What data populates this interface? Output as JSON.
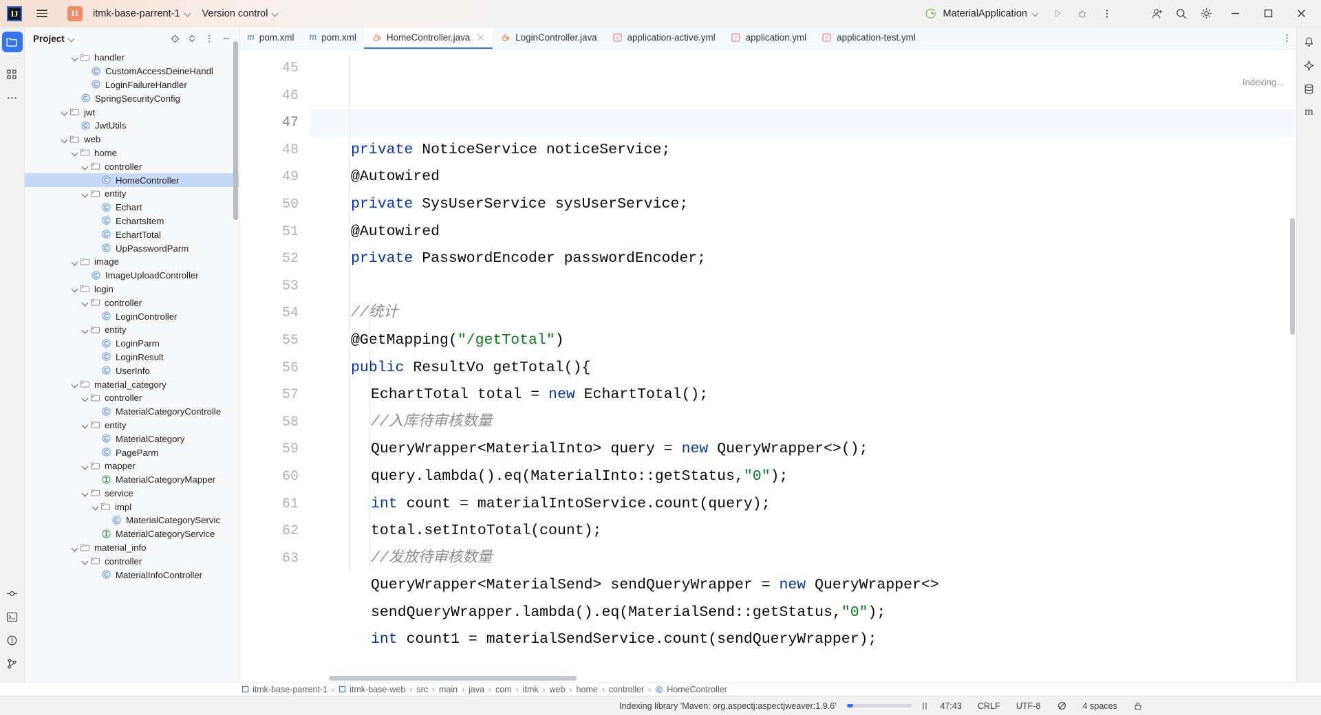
{
  "titlebar": {
    "logo_text": "IJ",
    "project_badge": "I1",
    "project_name": "itmk-base-parrent-1",
    "version_control": "Version control",
    "run_config": "MaterialApplication"
  },
  "project_panel": {
    "title": "Project",
    "tree": [
      {
        "depth": 4,
        "type": "folder",
        "label": "handler",
        "expanded": true
      },
      {
        "depth": 6,
        "type": "class",
        "label": "CustomAccessDeineHandl"
      },
      {
        "depth": 6,
        "type": "class",
        "label": "LoginFailureHandler"
      },
      {
        "depth": 5,
        "type": "class",
        "label": "SpringSecurityConfig"
      },
      {
        "depth": 3,
        "type": "folder",
        "label": "jwt",
        "expanded": true
      },
      {
        "depth": 5,
        "type": "class",
        "label": "JwtUtils"
      },
      {
        "depth": 3,
        "type": "folder",
        "label": "web",
        "expanded": true
      },
      {
        "depth": 4,
        "type": "folder",
        "label": "home",
        "expanded": true
      },
      {
        "depth": 5,
        "type": "folder",
        "label": "controller",
        "expanded": true
      },
      {
        "depth": 7,
        "type": "class",
        "label": "HomeController",
        "selected": true
      },
      {
        "depth": 5,
        "type": "folder",
        "label": "entity",
        "expanded": true
      },
      {
        "depth": 7,
        "type": "class",
        "label": "Echart"
      },
      {
        "depth": 7,
        "type": "class",
        "label": "EchartsItem"
      },
      {
        "depth": 7,
        "type": "class",
        "label": "EchartTotal"
      },
      {
        "depth": 7,
        "type": "class",
        "label": "UpPasswordParm"
      },
      {
        "depth": 4,
        "type": "folder",
        "label": "image",
        "expanded": true
      },
      {
        "depth": 6,
        "type": "class",
        "label": "ImageUploadController"
      },
      {
        "depth": 4,
        "type": "folder",
        "label": "login",
        "expanded": true
      },
      {
        "depth": 5,
        "type": "folder",
        "label": "controller",
        "expanded": true
      },
      {
        "depth": 7,
        "type": "class",
        "label": "LoginController"
      },
      {
        "depth": 5,
        "type": "folder",
        "label": "entity",
        "expanded": true
      },
      {
        "depth": 7,
        "type": "class",
        "label": "LoginParm"
      },
      {
        "depth": 7,
        "type": "class",
        "label": "LoginResult"
      },
      {
        "depth": 7,
        "type": "class",
        "label": "UserInfo"
      },
      {
        "depth": 4,
        "type": "folder",
        "label": "material_category",
        "expanded": true
      },
      {
        "depth": 5,
        "type": "folder",
        "label": "controller",
        "expanded": true
      },
      {
        "depth": 7,
        "type": "class",
        "label": "MaterialCategoryControlle"
      },
      {
        "depth": 5,
        "type": "folder",
        "label": "entity",
        "expanded": true
      },
      {
        "depth": 7,
        "type": "class",
        "label": "MaterialCategory"
      },
      {
        "depth": 7,
        "type": "class",
        "label": "PageParm"
      },
      {
        "depth": 5,
        "type": "folder",
        "label": "mapper",
        "expanded": true
      },
      {
        "depth": 7,
        "type": "interface",
        "label": "MaterialCategoryMapper"
      },
      {
        "depth": 5,
        "type": "folder",
        "label": "service",
        "expanded": true
      },
      {
        "depth": 6,
        "type": "folder",
        "label": "impl",
        "expanded": true
      },
      {
        "depth": 8,
        "type": "class",
        "label": "MaterialCategoryServic"
      },
      {
        "depth": 7,
        "type": "interface",
        "label": "MaterialCategoryService"
      },
      {
        "depth": 4,
        "type": "folder",
        "label": "material_info",
        "expanded": true
      },
      {
        "depth": 5,
        "type": "folder",
        "label": "controller",
        "expanded": true
      },
      {
        "depth": 7,
        "type": "class",
        "label": "MaterialInfoController"
      }
    ]
  },
  "editor": {
    "tabs": [
      {
        "label": "pom.xml",
        "icon": "maven-icon",
        "active": false,
        "closable": false
      },
      {
        "label": "pom.xml",
        "icon": "maven-icon",
        "active": false,
        "closable": false
      },
      {
        "label": "HomeController.java",
        "icon": "java-class-icon",
        "active": true,
        "closable": true
      },
      {
        "label": "LoginController.java",
        "icon": "java-class-icon",
        "active": false,
        "closable": false
      },
      {
        "label": "application-active.yml",
        "icon": "yaml-icon",
        "active": false,
        "closable": false
      },
      {
        "label": "application.yml",
        "icon": "yaml-icon",
        "active": false,
        "closable": false
      },
      {
        "label": "application-test.yml",
        "icon": "yaml-icon",
        "active": false,
        "closable": false
      }
    ],
    "indexing_badge": "Indexing...",
    "first_line_number": 45,
    "current_line": 47,
    "lines": [
      {
        "n": 45,
        "indent": 1,
        "tokens": [
          {
            "t": "private ",
            "c": "kw"
          },
          {
            "t": "NoticeService noticeService;",
            "c": ""
          }
        ]
      },
      {
        "n": 46,
        "indent": 1,
        "tokens": [
          {
            "t": "@Autowired",
            "c": ""
          }
        ]
      },
      {
        "n": 47,
        "indent": 1,
        "tokens": [
          {
            "t": "private ",
            "c": "kw"
          },
          {
            "t": "SysUserService sysUserService;",
            "c": ""
          }
        ]
      },
      {
        "n": 48,
        "indent": 1,
        "tokens": [
          {
            "t": "@Autowired",
            "c": ""
          }
        ]
      },
      {
        "n": 49,
        "indent": 1,
        "tokens": [
          {
            "t": "private ",
            "c": "kw"
          },
          {
            "t": "PasswordEncoder passwordEncoder;",
            "c": ""
          }
        ]
      },
      {
        "n": 50,
        "indent": 1,
        "tokens": []
      },
      {
        "n": 51,
        "indent": 1,
        "tokens": [
          {
            "t": "//统计",
            "c": "cmt"
          }
        ]
      },
      {
        "n": 52,
        "indent": 1,
        "tokens": [
          {
            "t": "@GetMapping(",
            "c": ""
          },
          {
            "t": "\"/getTotal\"",
            "c": "str"
          },
          {
            "t": ")",
            "c": ""
          }
        ]
      },
      {
        "n": 53,
        "indent": 1,
        "tokens": [
          {
            "t": "public ",
            "c": "kw"
          },
          {
            "t": "ResultVo getTotal(){",
            "c": ""
          }
        ]
      },
      {
        "n": 54,
        "indent": 2,
        "tokens": [
          {
            "t": "EchartTotal total = ",
            "c": ""
          },
          {
            "t": "new ",
            "c": "kw"
          },
          {
            "t": "EchartTotal();",
            "c": ""
          }
        ]
      },
      {
        "n": 55,
        "indent": 2,
        "tokens": [
          {
            "t": "//入库待审核数量",
            "c": "cmt"
          }
        ]
      },
      {
        "n": 56,
        "indent": 2,
        "tokens": [
          {
            "t": "QueryWrapper<MaterialInto> query = ",
            "c": ""
          },
          {
            "t": "new ",
            "c": "kw"
          },
          {
            "t": "QueryWrapper<>();",
            "c": ""
          }
        ]
      },
      {
        "n": 57,
        "indent": 2,
        "tokens": [
          {
            "t": "query.lambda().eq(MaterialInto::getStatus,",
            "c": ""
          },
          {
            "t": "\"0\"",
            "c": "str"
          },
          {
            "t": ");",
            "c": ""
          }
        ]
      },
      {
        "n": 58,
        "indent": 2,
        "tokens": [
          {
            "t": "int ",
            "c": "kw"
          },
          {
            "t": "count = materialIntoService.count(query);",
            "c": ""
          }
        ]
      },
      {
        "n": 59,
        "indent": 2,
        "tokens": [
          {
            "t": "total.setIntoTotal(count);",
            "c": ""
          }
        ]
      },
      {
        "n": 60,
        "indent": 2,
        "tokens": [
          {
            "t": "//发放待审核数量",
            "c": "cmt"
          }
        ]
      },
      {
        "n": 61,
        "indent": 2,
        "tokens": [
          {
            "t": "QueryWrapper<MaterialSend> sendQueryWrapper = ",
            "c": ""
          },
          {
            "t": "new ",
            "c": "kw"
          },
          {
            "t": "QueryWrapper<>",
            "c": ""
          }
        ]
      },
      {
        "n": 62,
        "indent": 2,
        "tokens": [
          {
            "t": "sendQueryWrapper.lambda().eq(MaterialSend::getStatus,",
            "c": ""
          },
          {
            "t": "\"0\"",
            "c": "str"
          },
          {
            "t": ");",
            "c": ""
          }
        ]
      },
      {
        "n": 63,
        "indent": 2,
        "tokens": [
          {
            "t": "int ",
            "c": "kw"
          },
          {
            "t": "count1 = materialSendService.count(sendQueryWrapper);",
            "c": ""
          }
        ]
      }
    ]
  },
  "breadcrumb": [
    {
      "label": "itmk-base-parrent-1",
      "icon": "module-icon"
    },
    {
      "label": "itmk-base-web",
      "icon": "module-icon"
    },
    {
      "label": "src",
      "icon": ""
    },
    {
      "label": "main",
      "icon": ""
    },
    {
      "label": "java",
      "icon": ""
    },
    {
      "label": "com",
      "icon": ""
    },
    {
      "label": "itmk",
      "icon": ""
    },
    {
      "label": "web",
      "icon": ""
    },
    {
      "label": "home",
      "icon": ""
    },
    {
      "label": "controller",
      "icon": ""
    },
    {
      "label": "HomeController",
      "icon": "class-icon"
    }
  ],
  "statusbar": {
    "indexing_message": "Indexing library 'Maven: org.aspectj:aspectjweaver:1.9.6'",
    "caret_position": "47:43",
    "line_separator": "CRLF",
    "encoding": "UTF-8",
    "indent": "4 spaces"
  },
  "colors": {
    "accent": "#3574f0",
    "selection": "#c7d9f7",
    "keyword": "#0033b3",
    "string": "#067d17",
    "comment": "#8c8c8c",
    "java_icon": "#e8743b",
    "yaml_icon": "#e8738a",
    "maven_icon": "#4a7ebb",
    "class_icon": "#6f9ce8",
    "project_badge_bg": "#ef8d6a"
  }
}
